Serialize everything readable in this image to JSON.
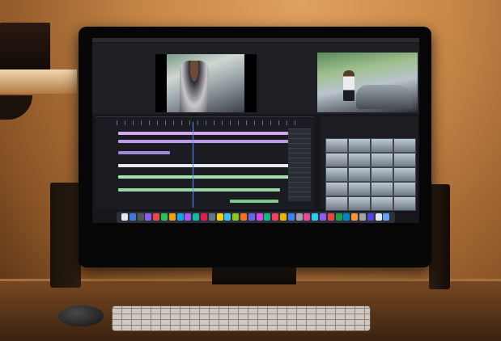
{
  "scene": {
    "colors": {
      "wall": "#c98848",
      "desk": "#6a3e1c",
      "monitor_bezel": "#060606",
      "editor_background": "#15171c",
      "video_track": "#b9d9b8",
      "audio_track_purple": "#c9a6e8",
      "playhead": "#5b8fff"
    },
    "icons": [
      "computer-mouse-icon",
      "keyboard-icon",
      "video-editor-app-icon",
      "dock-icon"
    ]
  },
  "tracks": [
    {
      "color": "#d4a8f0"
    },
    {
      "color": "#c19ae6"
    },
    {
      "color": "#9f87d8"
    },
    {
      "color": "#e8e8ee"
    },
    {
      "color": "#a7e3b0"
    },
    {
      "color": "#9ad6a3"
    },
    {
      "color": "#7fc98e"
    }
  ],
  "dock_icons": [
    "#e8e8e8",
    "#3a7bd5",
    "#555",
    "#8b5cf6",
    "#ef4444",
    "#22c55e",
    "#f59e0b",
    "#0ea5e9",
    "#a855f7",
    "#14b8a6",
    "#e11d48",
    "#64748b",
    "#facc15",
    "#38bdf8",
    "#84cc16",
    "#f97316",
    "#6366f1",
    "#d946ef",
    "#10b981",
    "#f43f5e",
    "#eab308",
    "#3b82f6",
    "#9ca3af",
    "#ec4899",
    "#22d3ee",
    "#8b5cf6",
    "#ef4444",
    "#16a34a",
    "#0284c7",
    "#fb923c",
    "#a3a3a3",
    "#4f46e5",
    "#e5e7eb",
    "#60a5fa"
  ]
}
